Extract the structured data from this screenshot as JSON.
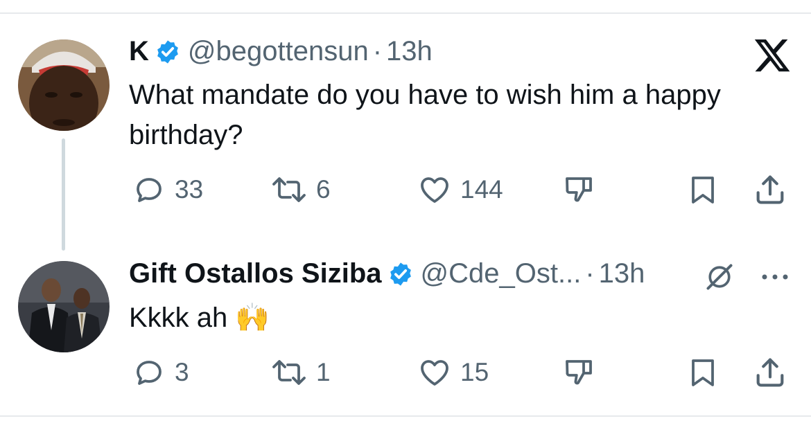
{
  "app": {
    "logo": "x-logo-icon"
  },
  "tweets": [
    {
      "name": "K",
      "handle": "@begottensun",
      "separator": "·",
      "time": "13h",
      "verified": true,
      "text": "What mandate do you have to wish him a happy birthday?",
      "actions": {
        "replies": "33",
        "reposts": "6",
        "likes": "144"
      }
    },
    {
      "name": "Gift Ostallos Siziba",
      "handle": "@Cde_Ost...",
      "separator": "·",
      "time": "13h",
      "verified": true,
      "text": "Kkkk  ah 🙌",
      "actions": {
        "replies": "3",
        "reposts": "1",
        "likes": "15"
      }
    }
  ],
  "icons": [
    "verified-badge-icon",
    "reply-icon",
    "repost-icon",
    "like-icon",
    "dislike-icon",
    "bookmark-icon",
    "share-icon",
    "grok-icon",
    "more-icon"
  ],
  "colors": {
    "verified": "#1d9bf0",
    "muted": "#536471",
    "text": "#0f1419",
    "thread_line": "#cfd9de"
  }
}
